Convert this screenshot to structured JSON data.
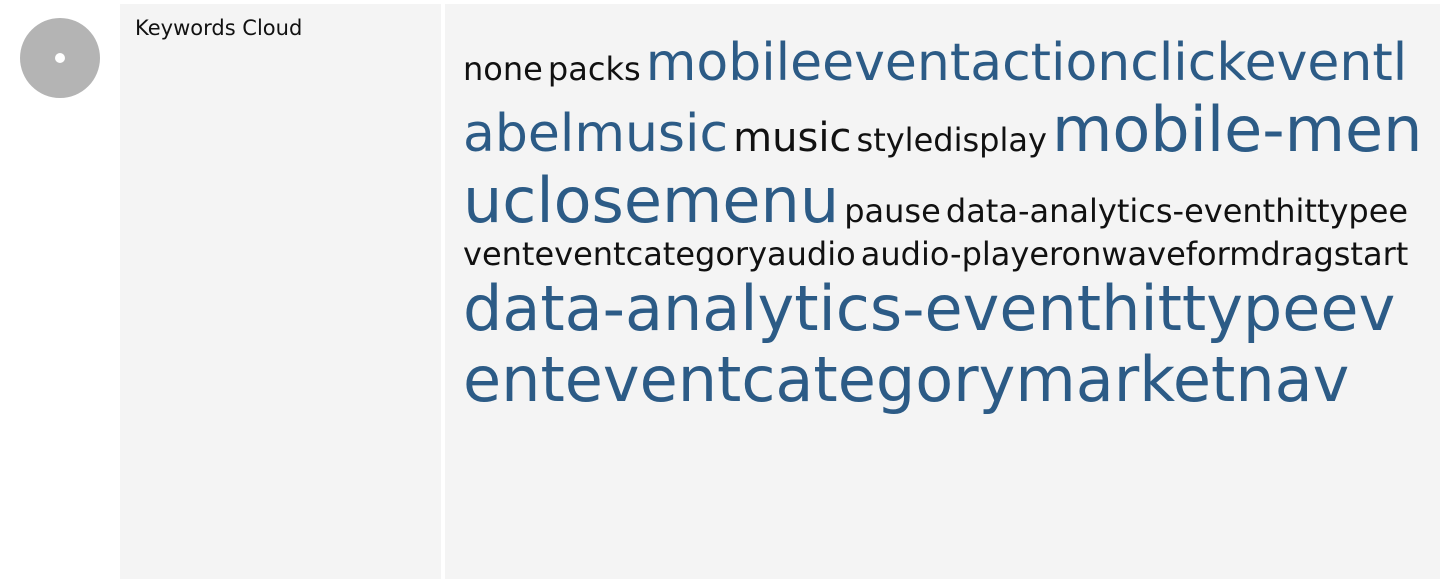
{
  "section": {
    "label": "Keywords Cloud",
    "icon": "keywords-cloud-icon"
  },
  "keywords": [
    {
      "text": "none",
      "weight": "small",
      "color": "#111111"
    },
    {
      "text": "packs",
      "weight": "small",
      "color": "#111111"
    },
    {
      "text": "mobileeventactionclickeventlabelmusic",
      "weight": "large",
      "color": "#2c5b86"
    },
    {
      "text": "music",
      "weight": "medium",
      "color": "#111111"
    },
    {
      "text": "styledisplay",
      "weight": "small",
      "color": "#111111"
    },
    {
      "text": "mobile-menuclosemenu",
      "weight": "xlarge",
      "color": "#2c5b86"
    },
    {
      "text": "pause",
      "weight": "small",
      "color": "#111111"
    },
    {
      "text": "data-analytics-eventhittypeeventeventcategoryaudio",
      "weight": "small",
      "color": "#111111"
    },
    {
      "text": "audio-playeronwaveformdragstart",
      "weight": "small",
      "color": "#111111"
    },
    {
      "text": "data-analytics-eventhittypeeventeventcategorymarketnav",
      "weight": "xlarge",
      "color": "#2c5b86"
    }
  ],
  "colors": {
    "accent": "#2c5b86",
    "text": "#111111",
    "panel": "#f4f4f4",
    "icon": "#b4b4b4"
  }
}
